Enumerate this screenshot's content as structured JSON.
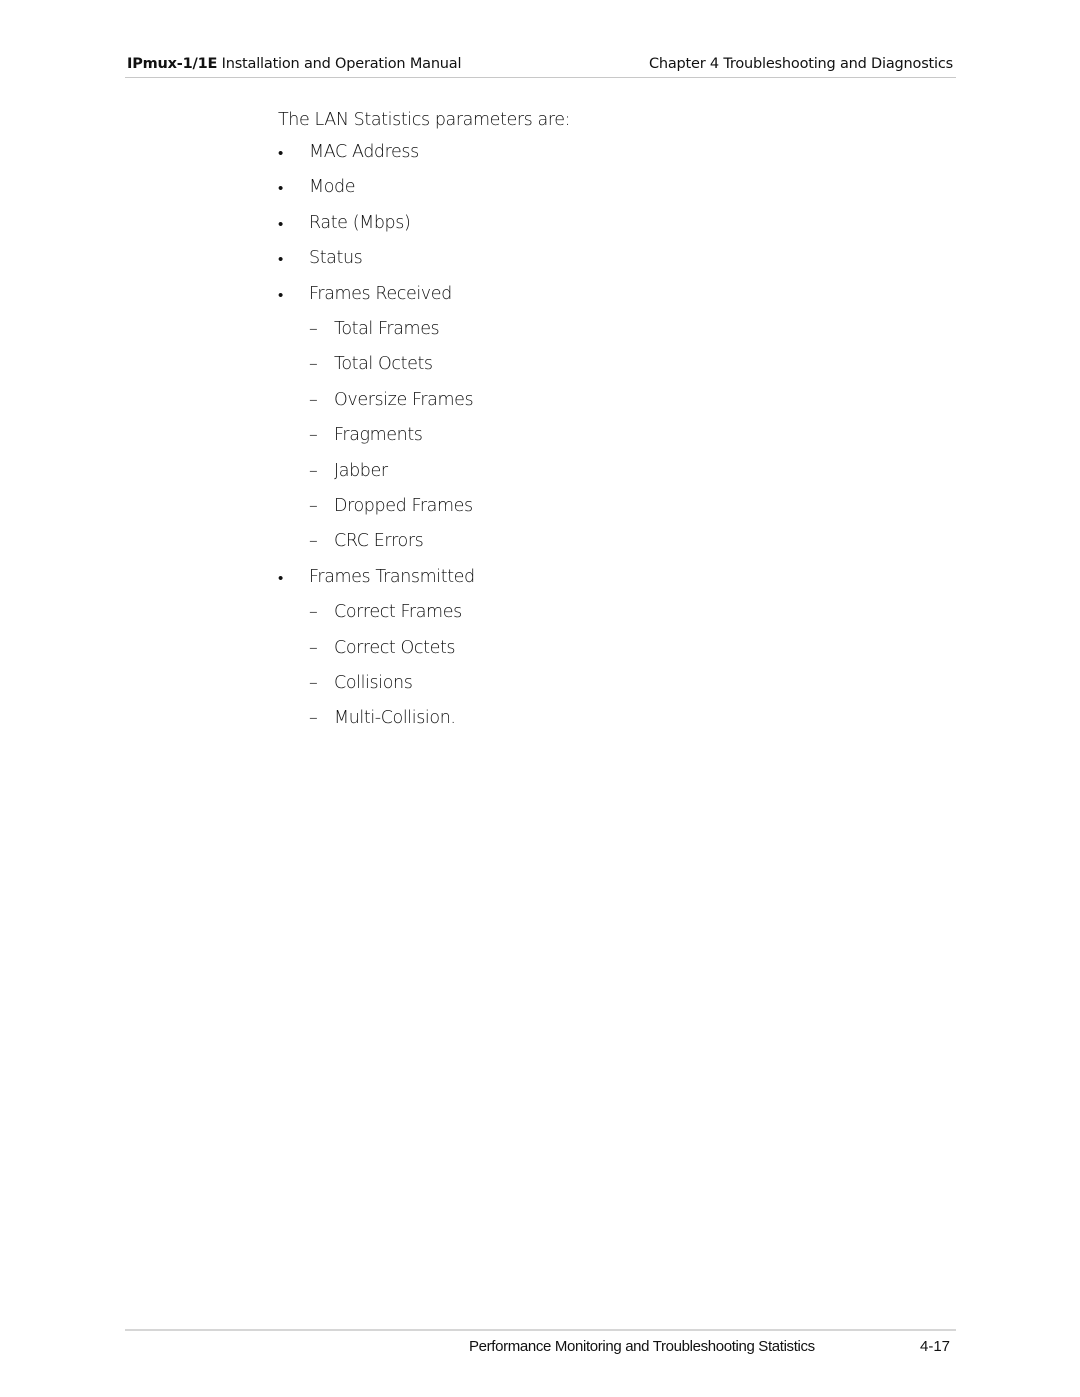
{
  "header": {
    "product": "IPmux-1/1E",
    "manual_title": "Installation and Operation Manual",
    "chapter": "Chapter 4  Troubleshooting and Diagnostics"
  },
  "body": {
    "intro": "The LAN Statistics parameters are:",
    "bullet_marker": "•",
    "dash_marker": "–",
    "items": [
      {
        "level": 1,
        "text": "MAC Address"
      },
      {
        "level": 1,
        "text": "Mode"
      },
      {
        "level": 1,
        "text": "Rate (Mbps)"
      },
      {
        "level": 1,
        "text": "Status"
      },
      {
        "level": 1,
        "text": "Frames Received"
      },
      {
        "level": 2,
        "text": "Total Frames"
      },
      {
        "level": 2,
        "text": "Total Octets"
      },
      {
        "level": 2,
        "text": "Oversize Frames"
      },
      {
        "level": 2,
        "text": "Fragments"
      },
      {
        "level": 2,
        "text": "Jabber"
      },
      {
        "level": 2,
        "text": "Dropped Frames"
      },
      {
        "level": 2,
        "text": "CRC Errors"
      },
      {
        "level": 1,
        "text": "Frames Transmitted"
      },
      {
        "level": 2,
        "text": "Correct Frames"
      },
      {
        "level": 2,
        "text": "Correct Octets"
      },
      {
        "level": 2,
        "text": "Collisions"
      },
      {
        "level": 2,
        "text": "Multi-Collision."
      }
    ]
  },
  "footer": {
    "section_title": "Performance Monitoring and Troubleshooting Statistics",
    "page_number": "4-17"
  }
}
